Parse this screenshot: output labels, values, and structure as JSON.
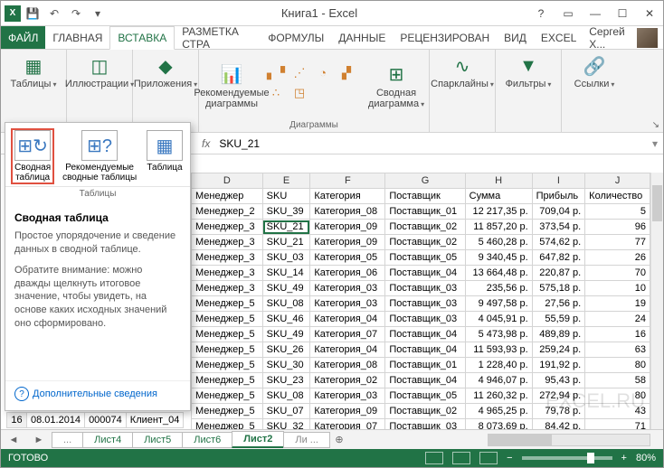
{
  "title": "Книга1 - Excel",
  "user": "Сергей Х...",
  "tabs": {
    "file": "ФАЙЛ",
    "home": "ГЛАВНАЯ",
    "insert": "ВСТАВКА",
    "page": "РАЗМЕТКА СТРА",
    "formulas": "ФОРМУЛЫ",
    "data": "ДАННЫЕ",
    "review": "РЕЦЕНЗИРОВАН",
    "view": "ВИД",
    "excel": "EXCEL"
  },
  "ribbon": {
    "tables": "Таблицы",
    "illustrations": "Иллюстрации",
    "apps": "Приложения",
    "rec_charts": "Рекомендуемые диаграммы",
    "charts_group": "Диаграммы",
    "pivot_chart": "Сводная диаграмма",
    "sparklines": "Спарклайны",
    "filters": "Фильтры",
    "links": "Ссылки"
  },
  "gallery": {
    "pivot": "Сводная таблица",
    "rec_pivot": "Рекомендуемые сводные таблицы",
    "table": "Таблица",
    "group": "Таблицы",
    "heading": "Сводная таблица",
    "desc1": "Простое упорядочение и сведение данных в сводной таблице.",
    "desc2": "Обратите внимание: можно дважды щелкнуть итоговое значение, чтобы увидеть, на основе каких исходных значений оно сформировано.",
    "more": "Дополнительные сведения"
  },
  "formula_value": "SKU_21",
  "columns": {
    "D": "Менеджер",
    "E": "SKU",
    "F": "Категория",
    "G": "Поставщик",
    "H": "Сумма",
    "I": "Прибыль",
    "J": "Количество"
  },
  "rows": [
    {
      "d": "Менеджер_2",
      "e": "SKU_39",
      "f": "Категория_08",
      "g": "Поставщик_01",
      "h": "12 217,35 р.",
      "i": "709,04 р.",
      "j": "5"
    },
    {
      "d": "Менеджер_3",
      "e": "SKU_21",
      "f": "Категория_09",
      "g": "Поставщик_02",
      "h": "11 857,20 р.",
      "i": "373,54 р.",
      "j": "96"
    },
    {
      "d": "Менеджер_3",
      "e": "SKU_21",
      "f": "Категория_09",
      "g": "Поставщик_02",
      "h": "5 460,28 р.",
      "i": "574,62 р.",
      "j": "77"
    },
    {
      "d": "Менеджер_3",
      "e": "SKU_03",
      "f": "Категория_05",
      "g": "Поставщик_05",
      "h": "9 340,45 р.",
      "i": "647,82 р.",
      "j": "26"
    },
    {
      "d": "Менеджер_3",
      "e": "SKU_14",
      "f": "Категория_06",
      "g": "Поставщик_04",
      "h": "13 664,48 р.",
      "i": "220,87 р.",
      "j": "70"
    },
    {
      "d": "Менеджер_3",
      "e": "SKU_49",
      "f": "Категория_03",
      "g": "Поставщик_03",
      "h": "235,56 р.",
      "i": "575,18 р.",
      "j": "10"
    },
    {
      "d": "Менеджер_5",
      "e": "SKU_08",
      "f": "Категория_03",
      "g": "Поставщик_03",
      "h": "9 497,58 р.",
      "i": "27,56 р.",
      "j": "19"
    },
    {
      "d": "Менеджер_5",
      "e": "SKU_46",
      "f": "Категория_04",
      "g": "Поставщик_03",
      "h": "4 045,91 р.",
      "i": "55,59 р.",
      "j": "24"
    },
    {
      "d": "Менеджер_5",
      "e": "SKU_49",
      "f": "Категория_07",
      "g": "Поставщик_04",
      "h": "5 473,98 р.",
      "i": "489,89 р.",
      "j": "16"
    },
    {
      "d": "Менеджер_5",
      "e": "SKU_26",
      "f": "Категория_04",
      "g": "Поставщик_04",
      "h": "11 593,93 р.",
      "i": "259,24 р.",
      "j": "63"
    },
    {
      "d": "Менеджер_5",
      "e": "SKU_30",
      "f": "Категория_08",
      "g": "Поставщик_01",
      "h": "1 228,40 р.",
      "i": "191,92 р.",
      "j": "80"
    },
    {
      "d": "Менеджер_5",
      "e": "SKU_23",
      "f": "Категория_02",
      "g": "Поставщик_04",
      "h": "4 946,07 р.",
      "i": "95,43 р.",
      "j": "58"
    },
    {
      "d": "Менеджер_5",
      "e": "SKU_08",
      "f": "Категория_03",
      "g": "Поставщик_05",
      "h": "11 260,32 р.",
      "i": "272,94 р.",
      "j": "80"
    },
    {
      "d": "Менеджер_5",
      "e": "SKU_07",
      "f": "Категория_09",
      "g": "Поставщик_02",
      "h": "4 965,25 р.",
      "i": "79,78 р.",
      "j": "43"
    },
    {
      "d": "Менеджер_5",
      "e": "SKU_32",
      "f": "Категория_07",
      "g": "Поставщик_03",
      "h": "8 073,69 р.",
      "i": "84,42 р.",
      "j": "71"
    }
  ],
  "left_fragment": [
    {
      "n": "16",
      "date": "08.01.2014",
      "code": "000074",
      "client": "Клиент_04"
    }
  ],
  "sheets": {
    "s4": "Лист4",
    "s5": "Лист5",
    "s6": "Лист6",
    "s2": "Лист2",
    "more": "Ли ..."
  },
  "status": {
    "ready": "ГОТОВО",
    "zoom": "80%"
  }
}
